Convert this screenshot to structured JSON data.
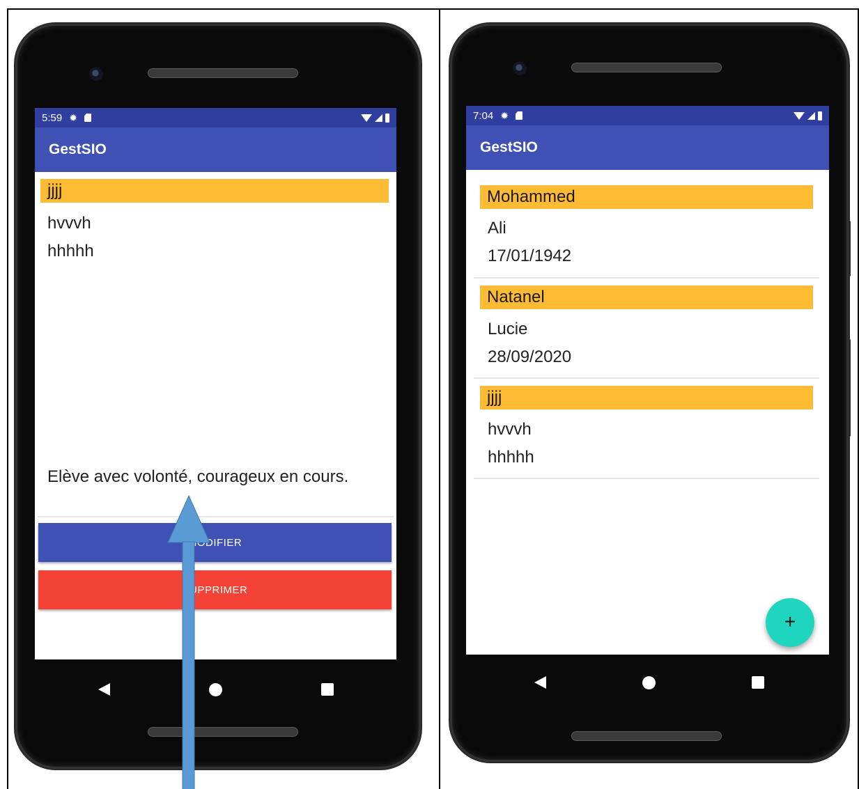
{
  "left_phone": {
    "status": {
      "time": "5:59"
    },
    "app_title": "GestSIO",
    "detail": {
      "name": "jjjj",
      "line1": "hvvvh",
      "line2": "hhhhh",
      "comment": "Elève avec volonté, courageux en cours."
    },
    "buttons": {
      "modify_label": "MODIFIER",
      "delete_label": "SUPPRIMER"
    }
  },
  "right_phone": {
    "status": {
      "time": "7:04"
    },
    "app_title": "GestSIO",
    "list": [
      {
        "name": "Mohammed",
        "line1": "Ali",
        "line2": "17/01/1942"
      },
      {
        "name": "Natanel",
        "line1": "Lucie",
        "line2": "28/09/2020"
      },
      {
        "name": "jjjj",
        "line1": "hvvvh",
        "line2": "hhhhh"
      }
    ],
    "fab_label": "+"
  },
  "colors": {
    "status_bar": "#303f9f",
    "app_bar": "#3f51b5",
    "name_highlight": "#ffbb33",
    "modify_button": "#3f51b5",
    "delete_button": "#f44336",
    "fab": "#1ed6c0",
    "annotation_arrow": "#5b9bd5"
  },
  "icons": [
    "settings-gear-icon",
    "sd-card-icon",
    "wifi-icon",
    "cell-signal-icon",
    "battery-icon",
    "nav-back-icon",
    "nav-home-icon",
    "nav-recent-icon",
    "add-icon"
  ]
}
